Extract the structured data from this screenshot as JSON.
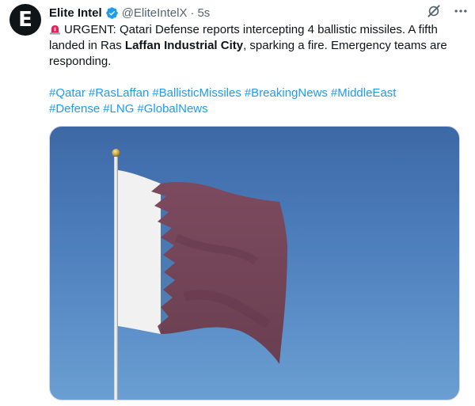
{
  "account": {
    "avatar_letter": "E",
    "name": "Elite Intel",
    "handle": "@EliteIntelX",
    "separator": "·",
    "time": "5s"
  },
  "tweet": {
    "text_part1": "URGENT: Qatari Defense reports intercepting 4 ballistic missiles. A fifth landed in Ras ",
    "text_bold": "Laffan Industrial City",
    "text_part2": ", sparking a fire. Emergency teams are responding."
  },
  "hashtags": [
    "#Qatar",
    "#RasLaffan",
    "#BallisticMissiles",
    "#BreakingNews",
    "#MiddleEast",
    "#Defense",
    "#LNG",
    "#GlobalNews"
  ],
  "colors": {
    "link": "#1d9bf0",
    "verified": "#1d9bf0",
    "flag_maroon": "#8a1538"
  },
  "icons": {
    "verified": "verified-badge-icon",
    "grok": "grok-icon",
    "more": "more-icon",
    "alarm": "rotating-light-icon"
  }
}
